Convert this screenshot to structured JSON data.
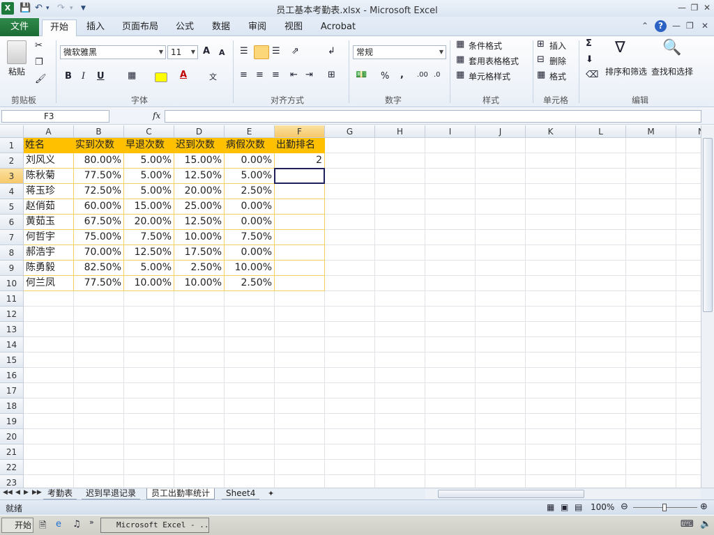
{
  "window": {
    "title": "员工基本考勤表.xlsx - Microsoft Excel",
    "app_icon": "X"
  },
  "ribbon_tabs": {
    "file": "文件",
    "tabs": [
      "开始",
      "插入",
      "页面布局",
      "公式",
      "数据",
      "审阅",
      "视图",
      "Acrobat"
    ],
    "active": "开始"
  },
  "ribbon": {
    "clipboard": {
      "paste": "粘贴",
      "label": "剪贴板"
    },
    "font": {
      "name": "微软雅黑",
      "size": "11",
      "label": "字体",
      "bold": "B",
      "italic": "I",
      "underline": "U",
      "grow": "A",
      "shrink": "A"
    },
    "alignment": {
      "label": "对齐方式"
    },
    "number": {
      "format": "常规",
      "label": "数字",
      "percent": "%",
      "comma": ","
    },
    "styles": {
      "conditional": "条件格式",
      "table": "套用表格格式",
      "cell": "单元格样式",
      "label": "样式"
    },
    "cells": {
      "insert": "插入",
      "delete": "删除",
      "format": "格式",
      "label": "单元格"
    },
    "editing": {
      "sort": "排序和筛选",
      "find": "查找和选择",
      "sum": "Σ",
      "label": "编辑"
    }
  },
  "formula_bar": {
    "name_box": "F3",
    "fx": "fx",
    "value": ""
  },
  "sheet": {
    "columns": [
      "A",
      "B",
      "C",
      "D",
      "E",
      "F",
      "G",
      "H",
      "I",
      "J",
      "K",
      "L",
      "M",
      "N"
    ],
    "rows": [
      "1",
      "2",
      "3",
      "4",
      "5",
      "6",
      "7",
      "8",
      "9",
      "10",
      "11",
      "12",
      "13",
      "14",
      "15",
      "16",
      "17",
      "18",
      "19",
      "20",
      "21",
      "22",
      "23"
    ],
    "selected_cell": "F3",
    "headers": [
      "姓名",
      "实到次数",
      "早退次数",
      "迟到次数",
      "病假次数",
      "出勤排名"
    ],
    "data": [
      [
        "刘风义",
        "80.00%",
        "5.00%",
        "15.00%",
        "0.00%",
        "2"
      ],
      [
        "陈秋菊",
        "77.50%",
        "5.00%",
        "12.50%",
        "5.00%",
        ""
      ],
      [
        "蒋玉珍",
        "72.50%",
        "5.00%",
        "20.00%",
        "2.50%",
        ""
      ],
      [
        "赵俏茹",
        "60.00%",
        "15.00%",
        "25.00%",
        "0.00%",
        ""
      ],
      [
        "黄茹玉",
        "67.50%",
        "20.00%",
        "12.50%",
        "0.00%",
        ""
      ],
      [
        "何哲宇",
        "75.00%",
        "7.50%",
        "10.00%",
        "7.50%",
        ""
      ],
      [
        "郝浩宇",
        "70.00%",
        "12.50%",
        "17.50%",
        "0.00%",
        ""
      ],
      [
        "陈勇毅",
        "82.50%",
        "5.00%",
        "2.50%",
        "10.00%",
        ""
      ],
      [
        "何兰凤",
        "77.50%",
        "10.00%",
        "10.00%",
        "2.50%",
        ""
      ]
    ]
  },
  "sheet_tabs": [
    "考勤表",
    "迟到早退记录",
    "员工出勤率统计",
    "Sheet4"
  ],
  "active_sheet": "员工出勤率统计",
  "status": {
    "text": "就绪",
    "zoom": "100%"
  },
  "taskbar": {
    "start": "开始",
    "task": "Microsoft Excel - ..."
  },
  "colors": {
    "header_fill": "#ffc000",
    "data_border": "#f0d060",
    "excel_green": "#1e7a3c"
  }
}
